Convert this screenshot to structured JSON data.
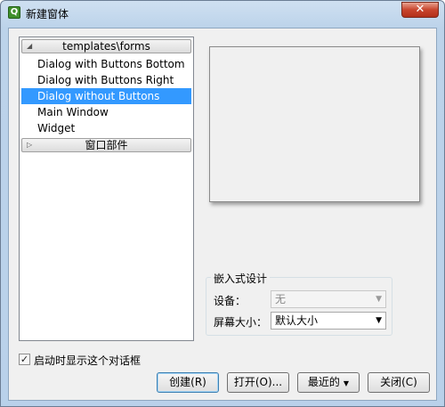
{
  "window": {
    "title": "新建窗体",
    "close_glyph": "✕",
    "app_icon_glyph": "Q"
  },
  "tree": {
    "groups": [
      {
        "label": "templates\\forms",
        "expanded": true,
        "items": [
          {
            "label": "Dialog with Buttons Bottom",
            "selected": false
          },
          {
            "label": "Dialog with Buttons Right",
            "selected": false
          },
          {
            "label": "Dialog without Buttons",
            "selected": true
          },
          {
            "label": "Main Window",
            "selected": false
          },
          {
            "label": "Widget",
            "selected": false
          }
        ]
      },
      {
        "label": "窗口部件",
        "expanded": false,
        "items": []
      }
    ]
  },
  "embedded": {
    "title": "嵌入式设计",
    "device_label": "设备：",
    "device_value": "无",
    "screen_label": "屏幕大小：",
    "screen_value": "默认大小"
  },
  "startup_checkbox": {
    "label": "启动时显示这个对话框",
    "checked": true
  },
  "buttons": {
    "create": "创建(R)",
    "open": "打开(O)...",
    "recent": "最近的",
    "close": "关闭(C)"
  },
  "colors": {
    "selection": "#3399ff",
    "title_gradient_top": "#cfe0f1",
    "close_button": "#c8452d"
  },
  "icons": {
    "expanded_arrow": "◢",
    "collapsed_arrow": "▷",
    "combo_arrow": "▼",
    "check_mark": "✓"
  }
}
